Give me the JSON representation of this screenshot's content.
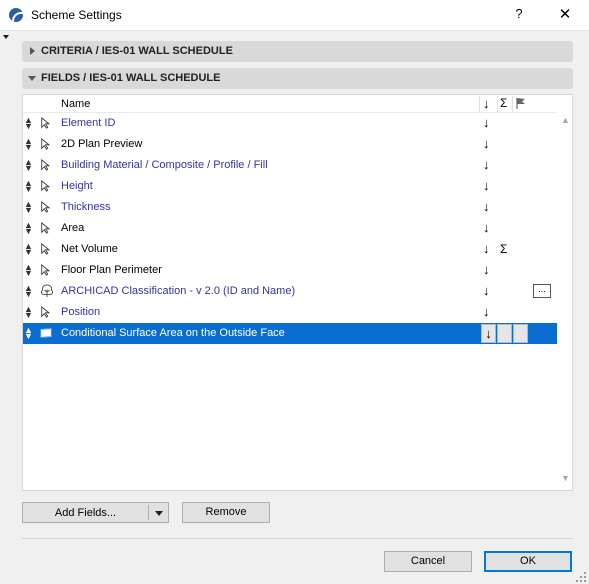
{
  "window": {
    "title": "Scheme Settings",
    "help_label": "?",
    "close_label": "✕"
  },
  "criteria_section": {
    "label": "CRITERIA / IES-01 WALL SCHEDULE",
    "expanded": false
  },
  "fields_section": {
    "label": "FIELDS / IES-01 WALL SCHEDULE",
    "expanded": true,
    "columns": {
      "name": "Name",
      "sort_icon": "↓",
      "sum_icon": "Σ",
      "flag_icon": "flag-icon"
    },
    "rows": [
      {
        "label": "Element ID",
        "icon": "pointer-icon",
        "link": true,
        "sort": "↓",
        "sum": "",
        "more": ""
      },
      {
        "label": "2D Plan Preview",
        "icon": "pointer-icon",
        "link": false,
        "sort": "↓",
        "sum": "",
        "more": ""
      },
      {
        "label": "Building Material / Composite / Profile / Fill",
        "icon": "pointer-icon",
        "link": true,
        "sort": "↓",
        "sum": "",
        "more": ""
      },
      {
        "label": "Height",
        "icon": "pointer-icon",
        "link": true,
        "sort": "↓",
        "sum": "",
        "more": ""
      },
      {
        "label": "Thickness",
        "icon": "pointer-icon",
        "link": true,
        "sort": "↓",
        "sum": "",
        "more": ""
      },
      {
        "label": "Area",
        "icon": "pointer-icon",
        "link": false,
        "sort": "↓",
        "sum": "",
        "more": ""
      },
      {
        "label": "Net Volume",
        "icon": "pointer-icon",
        "link": false,
        "sort": "↓",
        "sum": "Σ",
        "more": ""
      },
      {
        "label": "Floor Plan Perimeter",
        "icon": "pointer-icon",
        "link": false,
        "sort": "↓",
        "sum": "",
        "more": ""
      },
      {
        "label": "ARCHICAD Classification - v 2.0 (ID and Name)",
        "icon": "classification-tree-icon",
        "link": true,
        "sort": "↓",
        "sum": "",
        "more": "..."
      },
      {
        "label": "Position",
        "icon": "pointer-icon",
        "link": true,
        "sort": "↓",
        "sum": "",
        "more": ""
      }
    ],
    "selected_row": {
      "label": "Conditional Surface Area on the Outside Face",
      "icon": "surface-icon",
      "sort": "↓"
    }
  },
  "buttons": {
    "add_fields": "Add Fields...",
    "remove": "Remove",
    "cancel": "Cancel",
    "ok": "OK"
  },
  "colors": {
    "selection": "#0a6ed1",
    "link_text": "#3333aa",
    "section_header_bg": "#d9d9d9"
  }
}
